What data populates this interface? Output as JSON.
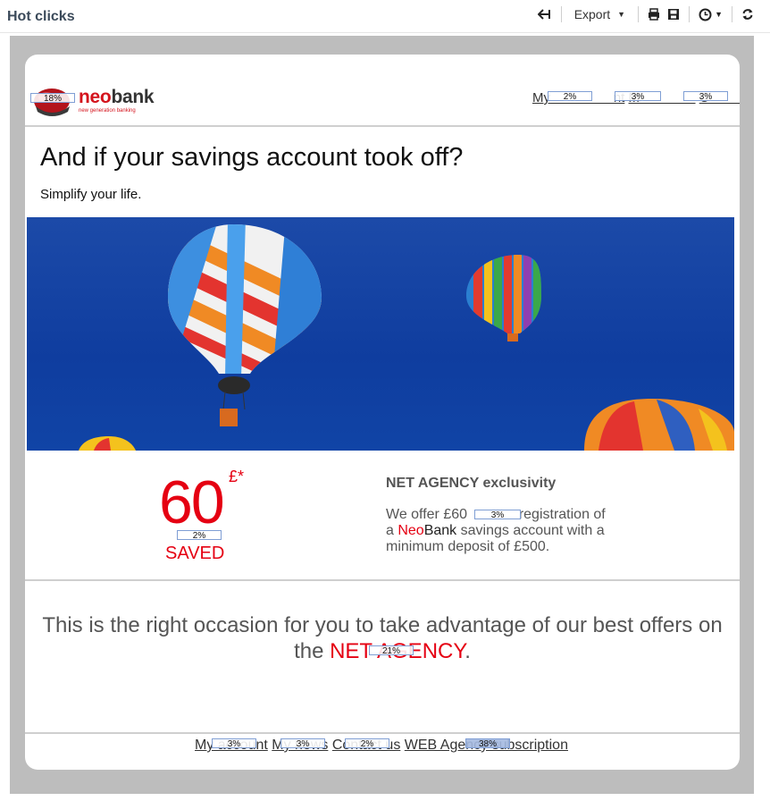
{
  "panel": {
    "title": "Hot clicks"
  },
  "toolbar": {
    "export_label": "Export"
  },
  "logo": {
    "neo": "neo",
    "bank": "bank",
    "tagline": "new generation banking"
  },
  "top_nav": {
    "link1": "My                 nt",
    "link2": "M               ",
    "link3": "C               s"
  },
  "headline": "And if your savings account took off?",
  "subhead": "Simplify your life.",
  "offer": {
    "amount": "60",
    "currency": "£*",
    "saved": "SAVED",
    "title": "NET AGENCY exclusivity",
    "text_before": "We offer £60             registration of a ",
    "neo": "Neo",
    "bank": "Bank",
    "text_after": " savings account with a minimum deposit of £500."
  },
  "occasion": {
    "line1": "This is the right occasion for you to take advantage of our best offers on",
    "the": "the ",
    "agency": "NET AGENCY",
    "period": "."
  },
  "footer_nav": {
    "link1": "My account",
    "link2": "My news",
    "link3": "Contact us",
    "link4": "WEB Agency subscription"
  },
  "hot_clicks": {
    "logo": "18%",
    "nav1": "2%",
    "nav2": "3%",
    "nav3": "3%",
    "amount": "2%",
    "registration": "3%",
    "agency": "21%",
    "foot1": "3%",
    "foot2": "3%",
    "foot3": "2%",
    "foot4": "38%"
  },
  "colors": {
    "brand_red": "#e50012",
    "sky": "#1448a8",
    "frame": "#bdbdbd",
    "heat_outline": "#7f9ed4"
  },
  "icons": [
    "back-arrow-icon",
    "print-icon",
    "save-icon",
    "clock-icon",
    "refresh-icon"
  ]
}
